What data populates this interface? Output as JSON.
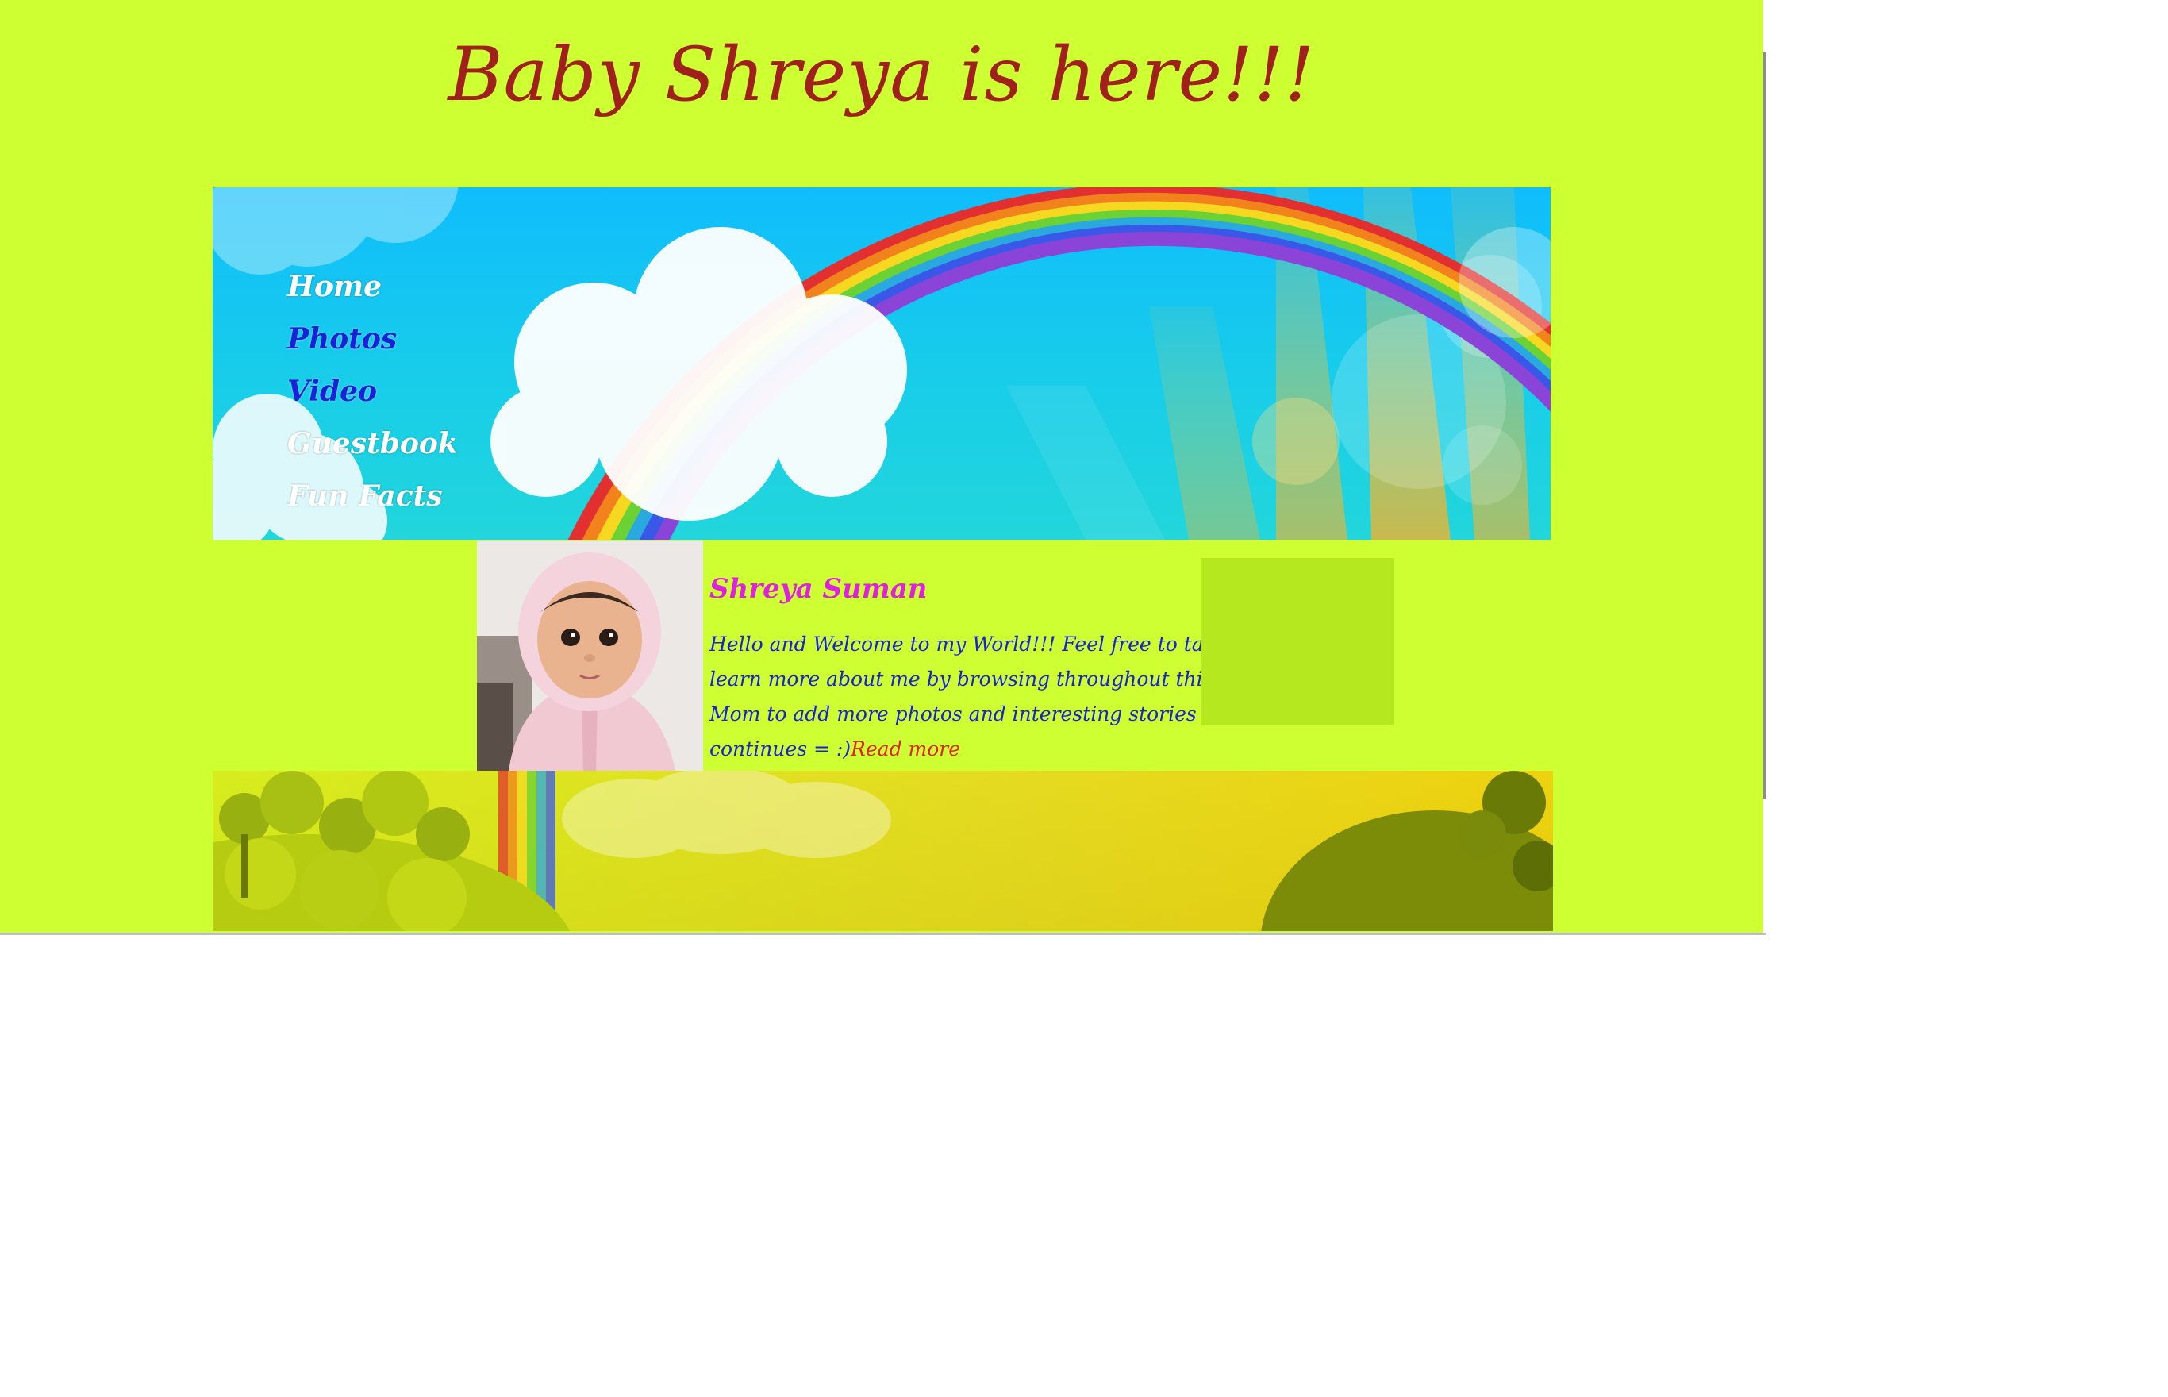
{
  "site": {
    "title": "Baby Shreya is here!!!"
  },
  "nav": {
    "items": [
      {
        "label": "Home"
      },
      {
        "label": "Photos"
      },
      {
        "label": "Video"
      },
      {
        "label": "Guestbook"
      },
      {
        "label": "Fun Facts"
      }
    ]
  },
  "profile": {
    "name": "Shreya Suman",
    "welcome_lines": [
      "Hello and Welcome to my World!!! Feel free to take a moment",
      "learn more about me by browsing throughout this site and , I'll as",
      "Mom to add more photos and interesting stories as our adventure",
      "continues = :)"
    ],
    "read_more": "Read more"
  },
  "colors": {
    "page_background": "#cdff33",
    "title": "#a0201c",
    "nav_active": "#1a22d8",
    "nav_default": "#ffffff",
    "profile_name": "#e020e0",
    "body_text": "#1a22d8",
    "link": "#e02010",
    "side_box": "#b6e820"
  },
  "images": {
    "banner": "rainbow-clouds-banner",
    "photo": "baby-portrait-photo",
    "footer": "rainbow-hills-footer"
  }
}
